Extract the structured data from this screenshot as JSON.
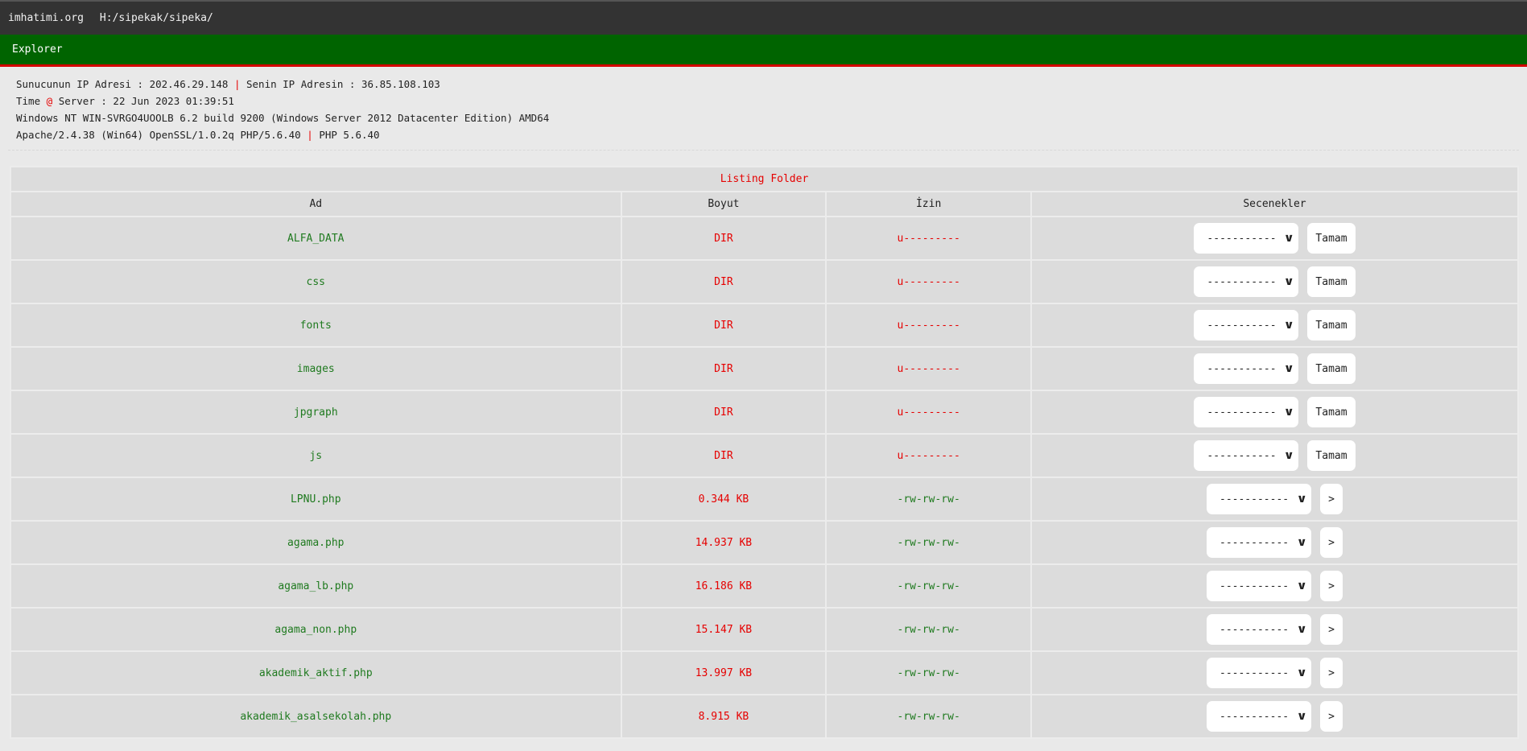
{
  "topbar": {
    "site": "imhatimi.org",
    "path": "H:/sipekak/sipeka/"
  },
  "nav": {
    "explorer": "Explorer"
  },
  "server_info": {
    "line1_label": "Sunucunun IP Adresi : 202.46.29.148",
    "line1_sep": "|",
    "line1_label2": "Senin IP Adresin : 36.85.108.103",
    "line2_a": "Time",
    "line2_at": "@",
    "line2_b": "Server : 22 Jun 2023 01:39:51",
    "line3": "Windows NT WIN-SVRGO4UOOLB 6.2 build 9200 (Windows Server 2012 Datacenter Edition) AMD64",
    "line4_a": "Apache/2.4.38 (Win64) OpenSSL/1.0.2q PHP/5.6.40",
    "line4_sep": "|",
    "line4_b": "PHP 5.6.40"
  },
  "table": {
    "caption": "Listing Folder",
    "headers": {
      "name": "Ad",
      "size": "Boyut",
      "perm": "İzin",
      "options": "Secenekler"
    },
    "rows": [
      {
        "name": "ALFA_DATA",
        "size": "DIR",
        "perm": "u---------",
        "select": "-----------",
        "action": "Tamam"
      },
      {
        "name": "css",
        "size": "DIR",
        "perm": "u---------",
        "select": "-----------",
        "action": "Tamam"
      },
      {
        "name": "fonts",
        "size": "DIR",
        "perm": "u---------",
        "select": "-----------",
        "action": "Tamam"
      },
      {
        "name": "images",
        "size": "DIR",
        "perm": "u---------",
        "select": "-----------",
        "action": "Tamam"
      },
      {
        "name": "jpgraph",
        "size": "DIR",
        "perm": "u---------",
        "select": "-----------",
        "action": "Tamam"
      },
      {
        "name": "js",
        "size": "DIR",
        "perm": "u---------",
        "select": "-----------",
        "action": "Tamam"
      },
      {
        "name": "LPNU.php",
        "size": "0.344 KB",
        "perm": "-rw-rw-rw-",
        "select": "-----------",
        "action": ">"
      },
      {
        "name": "agama.php",
        "size": "14.937 KB",
        "perm": "-rw-rw-rw-",
        "select": "-----------",
        "action": ">"
      },
      {
        "name": "agama_lb.php",
        "size": "16.186 KB",
        "perm": "-rw-rw-rw-",
        "select": "-----------",
        "action": ">"
      },
      {
        "name": "agama_non.php",
        "size": "15.147 KB",
        "perm": "-rw-rw-rw-",
        "select": "-----------",
        "action": ">"
      },
      {
        "name": "akademik_aktif.php",
        "size": "13.997 KB",
        "perm": "-rw-rw-rw-",
        "select": "-----------",
        "action": ">"
      },
      {
        "name": "akademik_asalsekolah.php",
        "size": "8.915 KB",
        "perm": "-rw-rw-rw-",
        "select": "-----------",
        "action": ">"
      }
    ]
  }
}
